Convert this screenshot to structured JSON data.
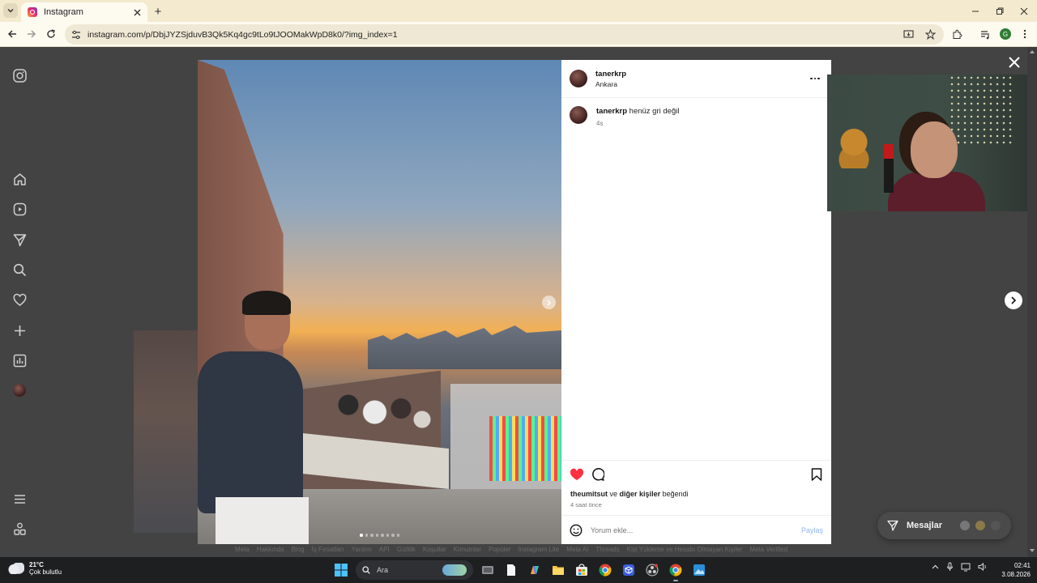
{
  "browser": {
    "tab_title": "Instagram",
    "new_tab": "+",
    "url": "instagram.com/p/DbjJYZSjduvB3Qk5Kq4gc9tLo9tJOOMakWpD8k0/?img_index=1",
    "profile_initial": "G"
  },
  "post": {
    "username": "tanerkrp",
    "location": "Ankara",
    "caption_user": "tanerkrp",
    "caption_text": "henüz gri değil",
    "caption_time": "4s",
    "likes_user": "theumitsut",
    "likes_connector": "ve",
    "likes_others": "diğer kişiler",
    "likes_suffix": "beğendi",
    "time_ago": "4 saat önce",
    "comment_placeholder": "Yorum ekle...",
    "share_label": "Paylaş",
    "image_count": 8,
    "active_image": 1,
    "liked": true
  },
  "footer_links": [
    "Meta",
    "Hakkında",
    "Blog",
    "İş Fırsatları",
    "Yardım",
    "API",
    "Gizlilik",
    "Koşullar",
    "Konumlar",
    "Popüler",
    "Instagram Lite",
    "Meta AI",
    "Threads",
    "Kişi Yükleme ve Hesabı Olmayan Kişiler",
    "Meta Verified"
  ],
  "messages": {
    "label": "Mesajlar"
  },
  "taskbar": {
    "temperature": "21°C",
    "weather": "Çok bulutlu",
    "search_label": "Ara",
    "time": "02:41",
    "date": "3.08.2026"
  },
  "colors": {
    "like_red": "#ff3040",
    "share_blue": "#8fb7ee",
    "page_dim": "#434343"
  }
}
